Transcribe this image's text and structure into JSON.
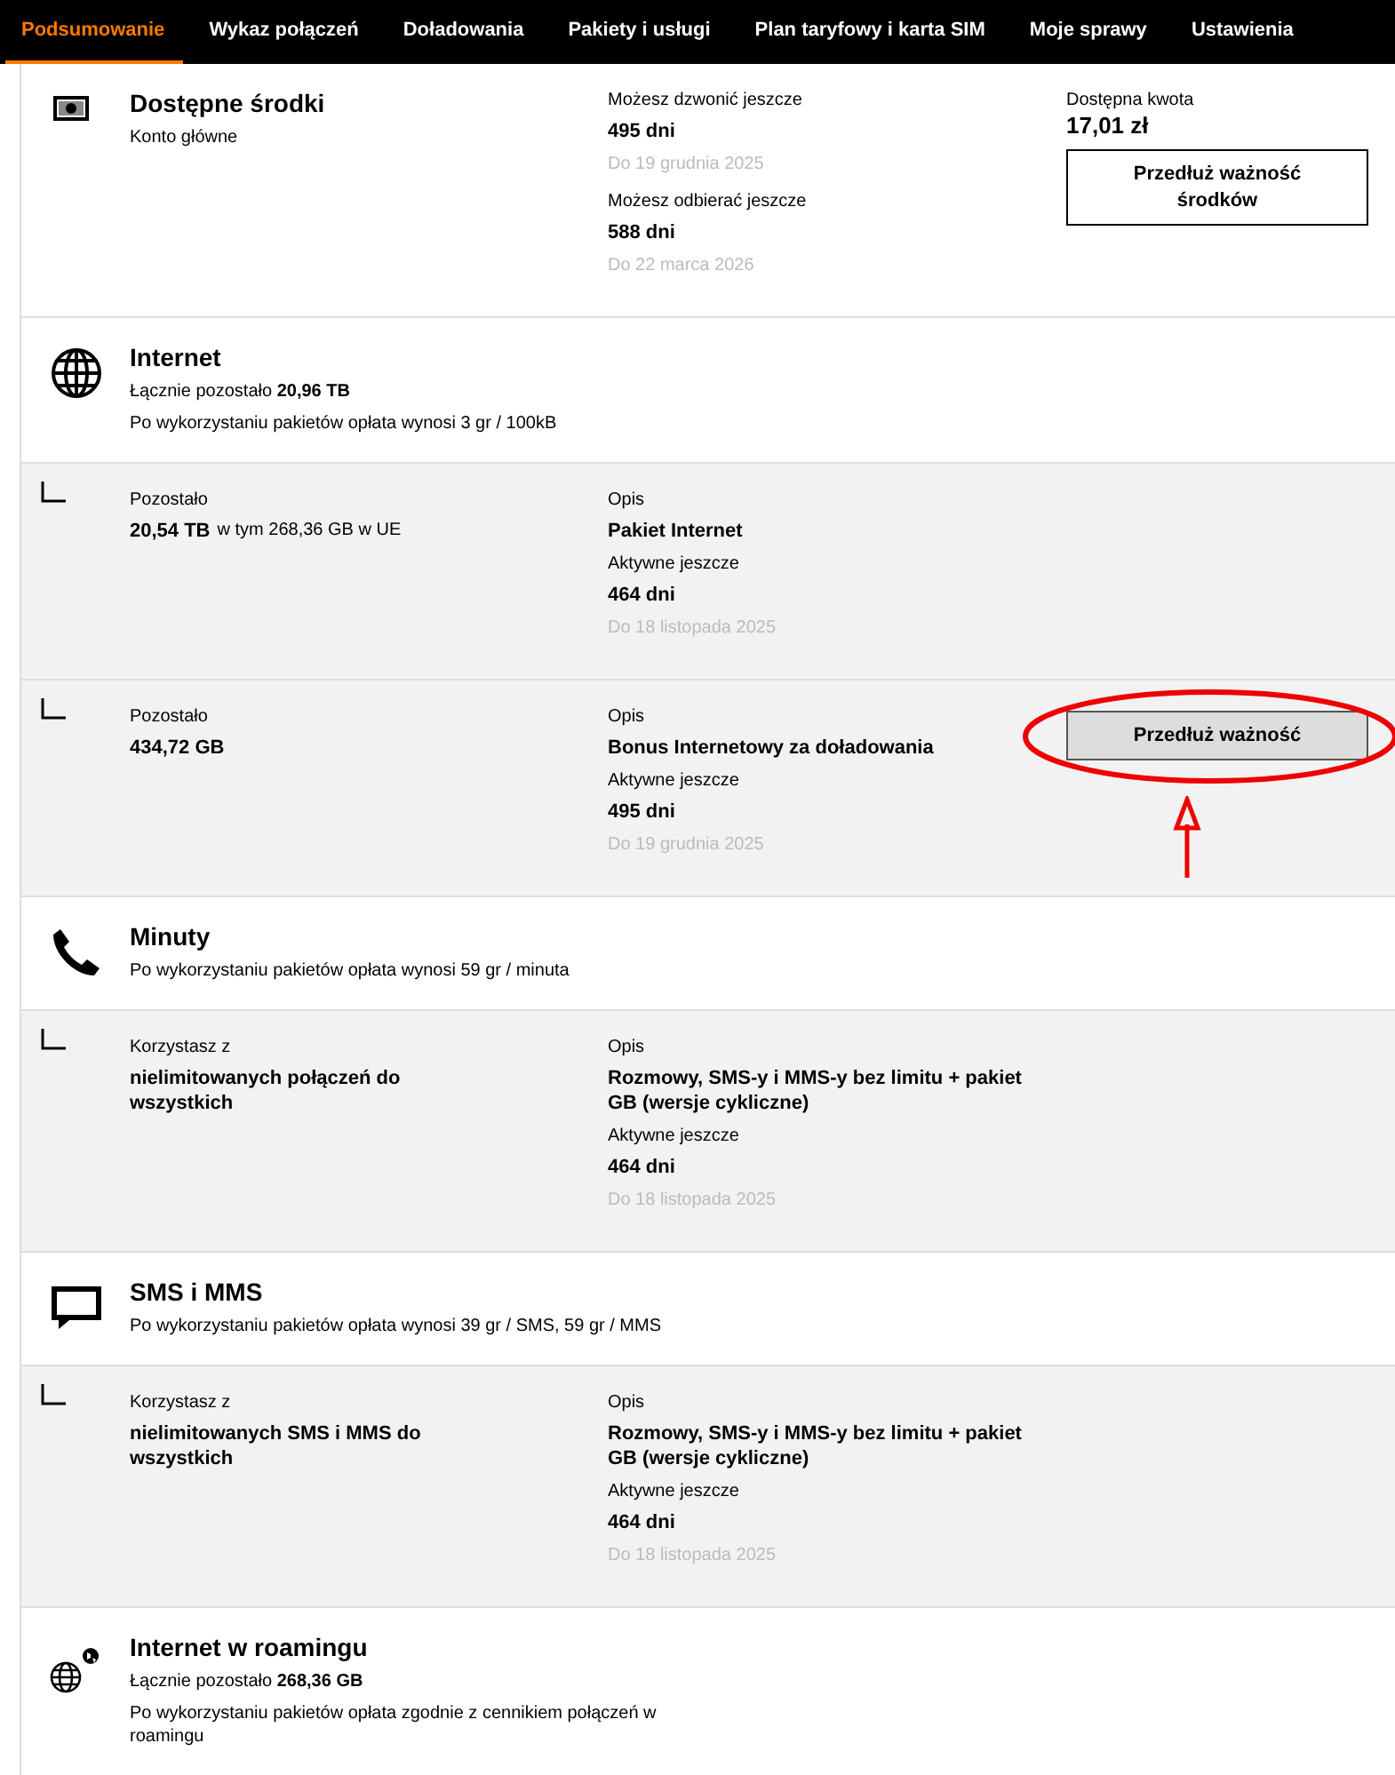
{
  "nav": {
    "tabs": [
      {
        "label": "Podsumowanie",
        "selected": true
      },
      {
        "label": "Wykaz połączeń",
        "selected": false
      },
      {
        "label": "Doładowania",
        "selected": false
      },
      {
        "label": "Pakiety i usługi",
        "selected": false
      },
      {
        "label": "Plan taryfowy i karta SIM",
        "selected": false
      },
      {
        "label": "Moje sprawy",
        "selected": false
      },
      {
        "label": "Ustawienia",
        "selected": false
      }
    ]
  },
  "funds": {
    "title": "Dostępne środki",
    "subtitle": "Konto główne",
    "blocks": [
      {
        "label": "Możesz dzwonić jeszcze",
        "value": "495 dni",
        "date": "Do 19 grudnia 2025"
      },
      {
        "label": "Możesz odbierać jeszcze",
        "value": "588 dni",
        "date": "Do 22 marca 2026"
      }
    ],
    "amount_label": "Dostępna kwota",
    "amount": "17,01 zł",
    "button": "Przedłuż ważność środków"
  },
  "sections": [
    {
      "kind": "globe",
      "title": "Internet",
      "lines": [
        "Łącznie pozostało **20,96 TB**",
        "Po wykorzystaniu pakietów opłata wynosi 3 gr / 100kB"
      ],
      "packages": [
        {
          "left_label": "Pozostało",
          "value": "20,54 TB",
          "note": "w tym 268,36 GB w UE",
          "desc_label": "Opis",
          "desc": "Pakiet Internet",
          "active_label": "Aktywne jeszcze",
          "days": "464 dni",
          "date": "Do 18 listopada 2025"
        },
        {
          "left_label": "Pozostało",
          "value": "434,72 GB",
          "desc_label": "Opis",
          "desc": "Bonus Internetowy za doładowania",
          "active_label": "Aktywne jeszcze",
          "days": "495 dni",
          "date": "Do 19 grudnia 2025",
          "button": "Przedłuż ważność",
          "annotated": true
        }
      ]
    },
    {
      "kind": "phone",
      "title": "Minuty",
      "lines": [
        "Po wykorzystaniu pakietów opłata wynosi 59 gr / minuta"
      ],
      "packages": [
        {
          "left_label": "Korzystasz z",
          "value": "nielimitowanych połączeń do wszystkich",
          "desc_label": "Opis",
          "desc": "Rozmowy, SMS-y i MMS-y bez limitu + pakiet GB (wersje cykliczne)",
          "active_label": "Aktywne jeszcze",
          "days": "464 dni",
          "date": "Do 18 listopada 2025"
        }
      ]
    },
    {
      "kind": "chat",
      "title": "SMS i MMS",
      "lines": [
        "Po wykorzystaniu pakietów opłata wynosi 39 gr / SMS, 59 gr / MMS"
      ],
      "packages": [
        {
          "left_label": "Korzystasz z",
          "value": "nielimitowanych SMS i MMS do wszystkich",
          "desc_label": "Opis",
          "desc": "Rozmowy, SMS-y i MMS-y bez limitu + pakiet GB (wersje cykliczne)",
          "active_label": "Aktywne jeszcze",
          "days": "464 dni",
          "date": "Do 18 listopada 2025"
        }
      ]
    },
    {
      "kind": "roaming",
      "title": "Internet w roamingu",
      "lines": [
        "Łącznie pozostało **268,36 GB**",
        "Po wykorzystaniu pakietów opłata zgodnie z cennikiem połączeń w roamingu"
      ]
    }
  ]
}
